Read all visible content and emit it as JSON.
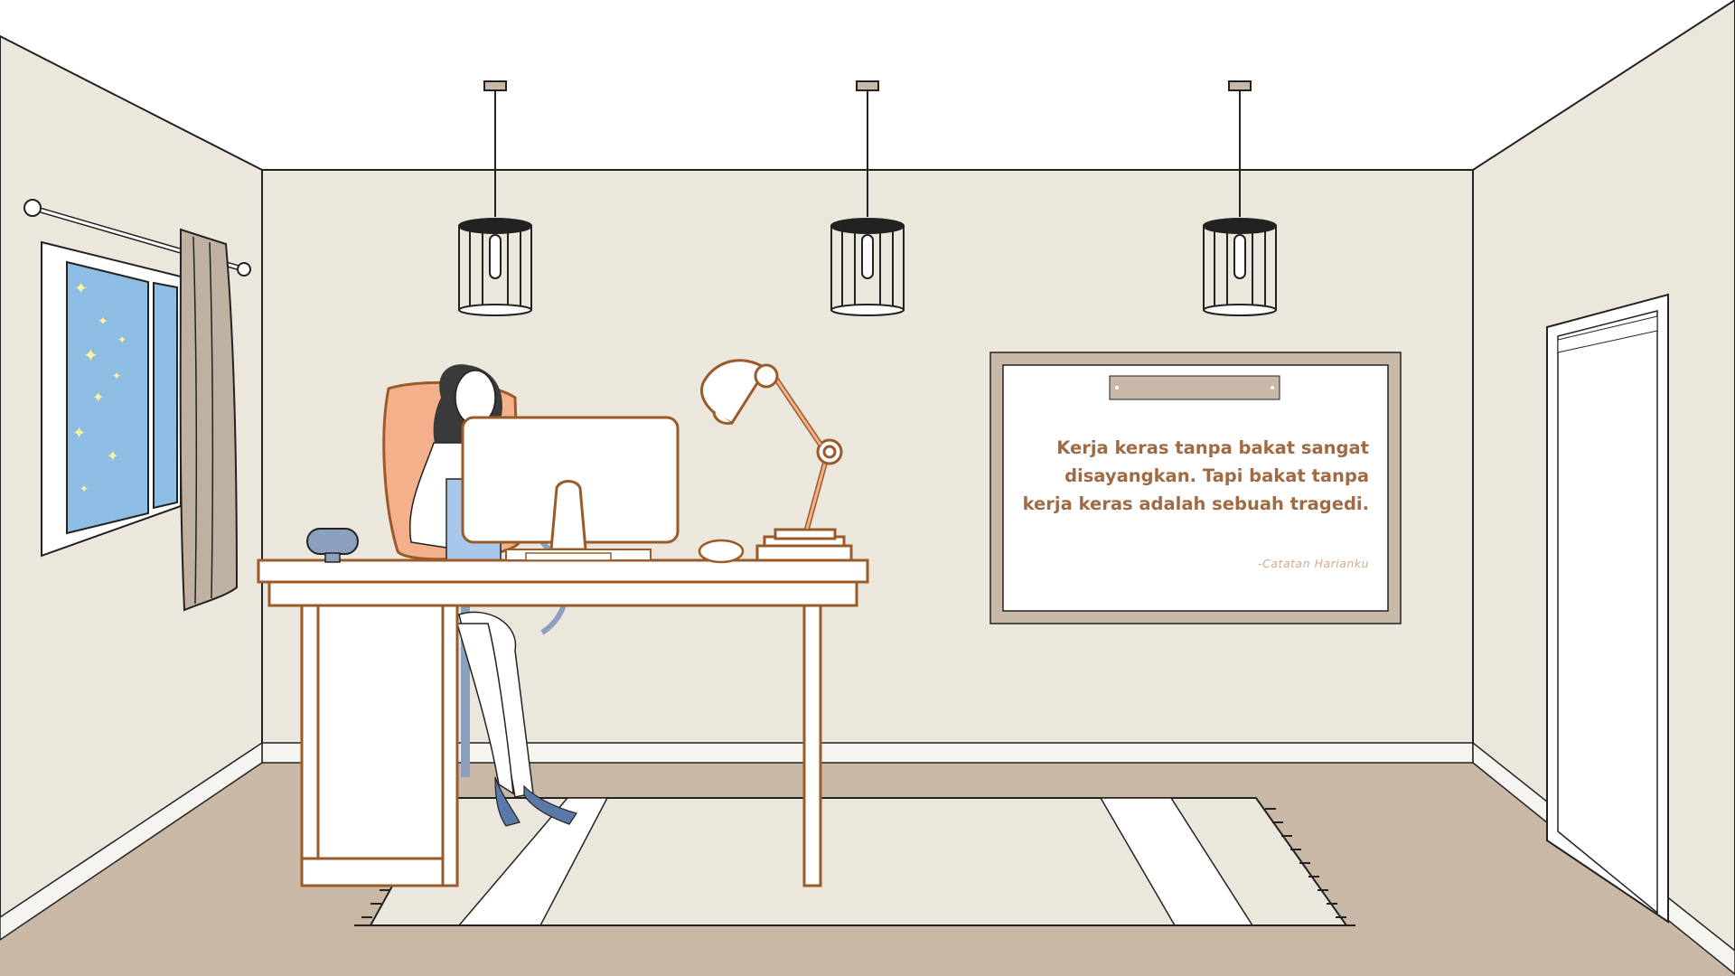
{
  "scene": {
    "description_free": true,
    "colors": {
      "wall": "#ebe7dc",
      "ceiling": "#ffffff",
      "floor": "#c9b8a6",
      "rug": "#ebe7dc",
      "wood_outline": "#9a5b2a",
      "window_sky": "#8dbde3",
      "curtain": "#bfb1a1",
      "chair": "#f4b08a",
      "quote_text": "#a06a44",
      "frame": "#c8b8a8",
      "skirt": "#a8c8ea"
    },
    "icons": [
      "pendant-lamp-icon",
      "desk-lamp-icon",
      "monitor-icon",
      "window-icon",
      "door-icon",
      "rug-icon",
      "desk-icon",
      "chair-icon",
      "person-icon",
      "mouse-icon",
      "books-icon",
      "webcam-icon"
    ]
  },
  "quote": {
    "line1": "Kerja keras tanpa bakat sangat",
    "line2": "disayangkan. Tapi bakat tanpa",
    "line3": "kerja keras adalah sebuah tragedi.",
    "author": "-Catatan Harianku"
  }
}
